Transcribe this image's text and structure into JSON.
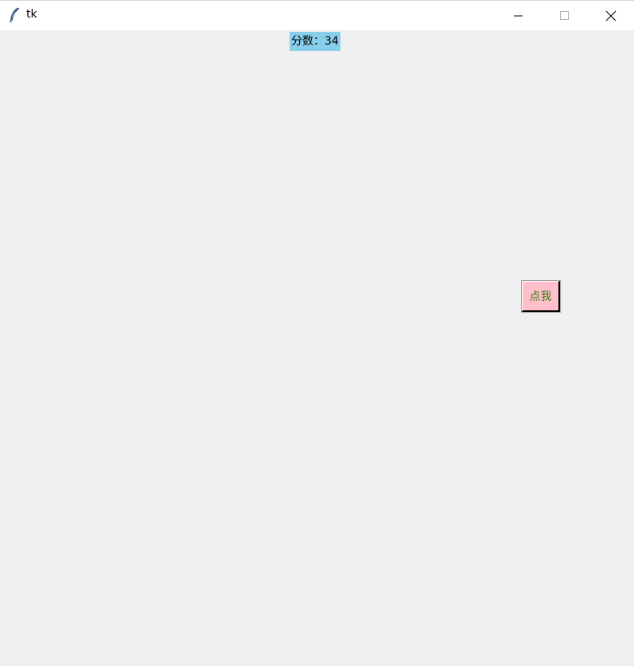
{
  "window": {
    "title": "tk",
    "icon": "feather-icon",
    "controls": {
      "minimize_icon": "minimize-icon",
      "maximize_icon": "maximize-icon",
      "close_icon": "close-icon"
    }
  },
  "score": {
    "text": "分数：34",
    "background_color": "#87ceeb"
  },
  "button": {
    "label": "点我",
    "background_color": "#ffc0cb",
    "text_color": "#3a7a10"
  },
  "colors": {
    "client_background": "#f0f0f0",
    "titlebar_background": "#ffffff"
  }
}
